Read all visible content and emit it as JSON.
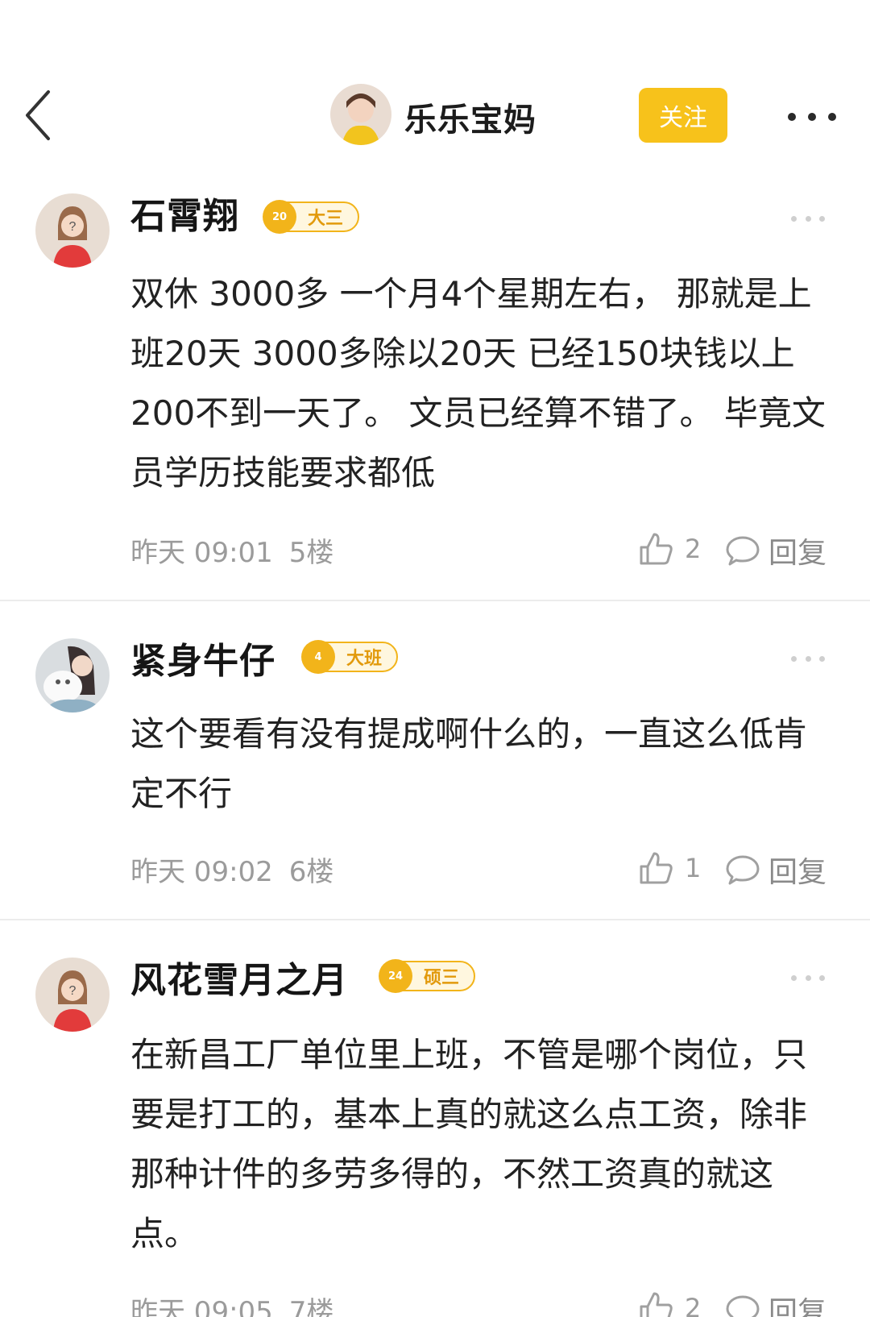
{
  "header": {
    "author_name": "乐乐宝妈",
    "follow_label": "关注"
  },
  "comments": [
    {
      "username": "石霄翔",
      "badge_level": "20",
      "badge_label": "大三",
      "text": "双休 3000多 一个月4个星期左右， 那就是上班20天 3000多除以20天 已经150块钱以上200不到一天了。 文员已经算不错了。 毕竟文员学历技能要求都低",
      "time": "昨天 09:01",
      "floor": "5楼",
      "likes": "2",
      "reply_label": "回复"
    },
    {
      "username": "紧身牛仔",
      "badge_level": "4",
      "badge_label": "大班",
      "text": "这个要看有没有提成啊什么的，一直这么低肯定不行",
      "time": "昨天 09:02",
      "floor": "6楼",
      "likes": "1",
      "reply_label": "回复"
    },
    {
      "username": "风花雪月之月",
      "badge_level": "24",
      "badge_label": "硕三",
      "text": "在新昌工厂单位里上班，不管是哪个岗位，只要是打工的，基本上真的就这么点工资，除非那种计件的多劳多得的，不然工资真的就这点。",
      "time": "昨天 09:05",
      "floor": "7楼",
      "likes": "2",
      "reply_label": "回复"
    }
  ]
}
